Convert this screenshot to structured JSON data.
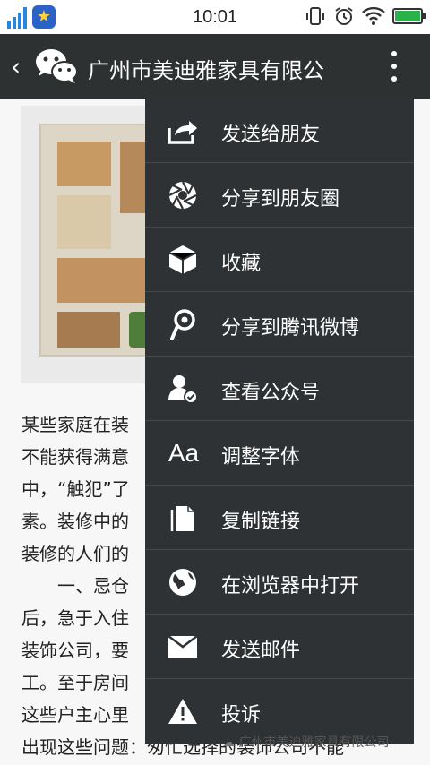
{
  "status_bar": {
    "time": "10:01",
    "icons": [
      "signal-icon",
      "qq-star-icon",
      "vibrate-icon",
      "alarm-icon",
      "wifi-icon",
      "battery-icon"
    ]
  },
  "header": {
    "title": "广州市美迪雅家具有限公"
  },
  "menu": {
    "items": [
      {
        "icon": "share-icon",
        "label": "发送给朋友"
      },
      {
        "icon": "moments-icon",
        "label": "分享到朋友圈"
      },
      {
        "icon": "favorite-icon",
        "label": "收藏"
      },
      {
        "icon": "weibo-icon",
        "label": "分享到腾讯微博"
      },
      {
        "icon": "official-account-icon",
        "label": "查看公众号"
      },
      {
        "icon": "font-size-icon",
        "label": "调整字体"
      },
      {
        "icon": "copy-link-icon",
        "label": "复制链接"
      },
      {
        "icon": "globe-icon",
        "label": "在浏览器中打开"
      },
      {
        "icon": "mail-icon",
        "label": "发送邮件"
      },
      {
        "icon": "report-icon",
        "label": "投诉"
      }
    ]
  },
  "article": {
    "lines": [
      "某些家庭在装",
      "不能获得满意",
      "中，“触犯”了",
      "素。装修中的",
      "装修的人们的",
      "　　一、忌仓",
      "后，急于入住",
      "装饰公司，要",
      "工。至于房间",
      "这些户主心里",
      "出现这些问题：匆忙选择的装饰公司不能"
    ]
  },
  "watermark": "广州市美迪雅家具有限公司"
}
